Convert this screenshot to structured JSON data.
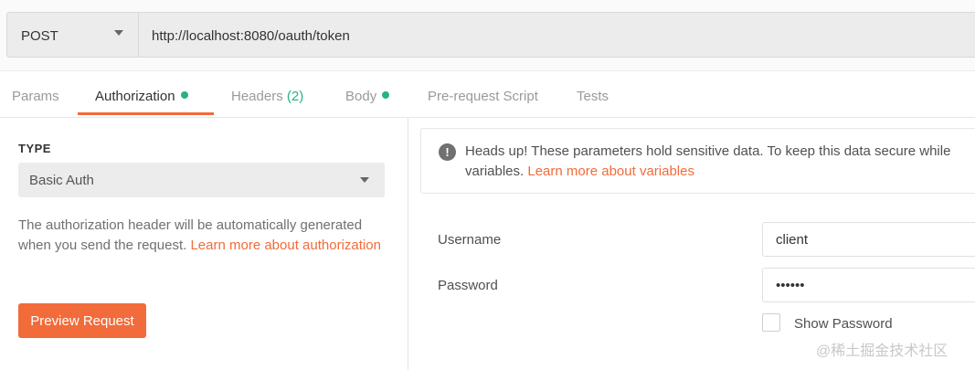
{
  "request": {
    "method": "POST",
    "url": "http://localhost:8080/oauth/token"
  },
  "tabs": [
    {
      "label": "Params"
    },
    {
      "label": "Authorization"
    },
    {
      "label": "Headers",
      "count": "(2)"
    },
    {
      "label": "Body"
    },
    {
      "label": "Pre-request Script"
    },
    {
      "label": "Tests"
    }
  ],
  "auth": {
    "type_label": "TYPE",
    "type_value": "Basic Auth",
    "description": "The authorization header will be automatically generated when you send the request.",
    "learn_more": "Learn more about authorization",
    "preview_button": "Preview Request"
  },
  "notice": {
    "text": "Heads up! These parameters hold sensitive data. To keep this data secure while",
    "text2": "variables.",
    "link": "Learn more about variables"
  },
  "fields": {
    "username_label": "Username",
    "username_value": "client",
    "password_label": "Password",
    "password_value": "••••••",
    "show_password_label": "Show Password"
  },
  "watermark": "@稀土掘金技术社区",
  "colors": {
    "accent": "#f26b3a",
    "indicator": "#26b47f"
  }
}
